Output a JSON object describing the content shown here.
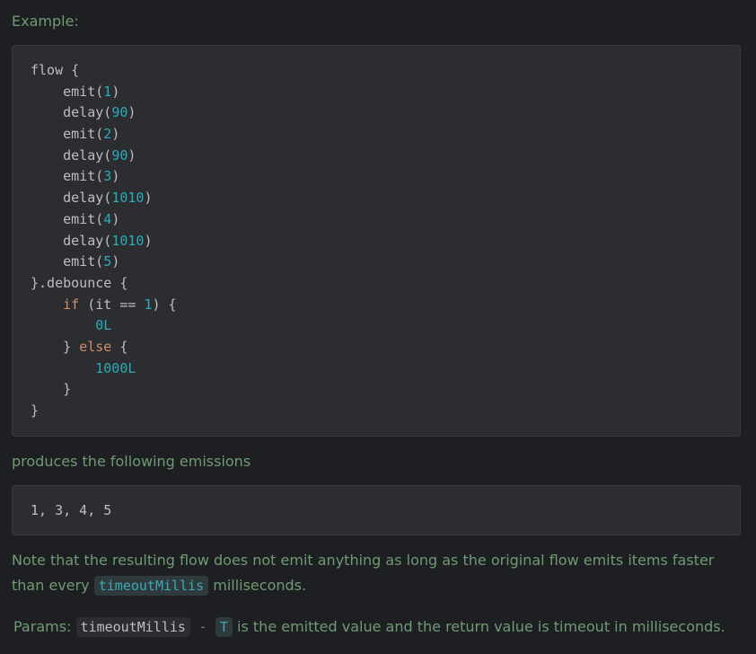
{
  "example_label": "Example:",
  "code1": {
    "lines": [
      [
        {
          "t": "flow {"
        }
      ],
      [
        {
          "t": "    emit("
        },
        {
          "t": "1",
          "c": "num"
        },
        {
          "t": ")"
        }
      ],
      [
        {
          "t": "    delay("
        },
        {
          "t": "90",
          "c": "num"
        },
        {
          "t": ")"
        }
      ],
      [
        {
          "t": "    emit("
        },
        {
          "t": "2",
          "c": "num"
        },
        {
          "t": ")"
        }
      ],
      [
        {
          "t": "    delay("
        },
        {
          "t": "90",
          "c": "num"
        },
        {
          "t": ")"
        }
      ],
      [
        {
          "t": "    emit("
        },
        {
          "t": "3",
          "c": "num"
        },
        {
          "t": ")"
        }
      ],
      [
        {
          "t": "    delay("
        },
        {
          "t": "1010",
          "c": "num"
        },
        {
          "t": ")"
        }
      ],
      [
        {
          "t": "    emit("
        },
        {
          "t": "4",
          "c": "num"
        },
        {
          "t": ")"
        }
      ],
      [
        {
          "t": "    delay("
        },
        {
          "t": "1010",
          "c": "num"
        },
        {
          "t": ")"
        }
      ],
      [
        {
          "t": "    emit("
        },
        {
          "t": "5",
          "c": "num"
        },
        {
          "t": ")"
        }
      ],
      [
        {
          "t": "}.debounce {"
        }
      ],
      [
        {
          "t": "    "
        },
        {
          "t": "if",
          "c": "kw"
        },
        {
          "t": " (it == "
        },
        {
          "t": "1",
          "c": "num"
        },
        {
          "t": ") {"
        }
      ],
      [
        {
          "t": "        "
        },
        {
          "t": "0L",
          "c": "num"
        }
      ],
      [
        {
          "t": "    } "
        },
        {
          "t": "else",
          "c": "kw"
        },
        {
          "t": " {"
        }
      ],
      [
        {
          "t": "        "
        },
        {
          "t": "1000L",
          "c": "num"
        }
      ],
      [
        {
          "t": "    }"
        }
      ],
      [
        {
          "t": "}"
        }
      ]
    ]
  },
  "produces_text": "produces the following emissions",
  "code2_text": "1, 3, 4, 5",
  "note": {
    "part1": "Note that the resulting flow does not emit anything as long as the original flow emits items faster than every ",
    "code": "timeoutMillis",
    "part2": " milliseconds."
  },
  "params": {
    "label": "Params:",
    "name": "timeoutMillis",
    "dash": "-",
    "type": "T",
    "description": "is the emitted value and the return value is timeout in milliseconds."
  },
  "colors": {
    "background": "#1e1f22",
    "code_bg": "#2b2d30",
    "doc_text": "#6f9a73",
    "code_text": "#bcbec4",
    "number": "#2aacb8",
    "keyword": "#cf8e6d"
  }
}
